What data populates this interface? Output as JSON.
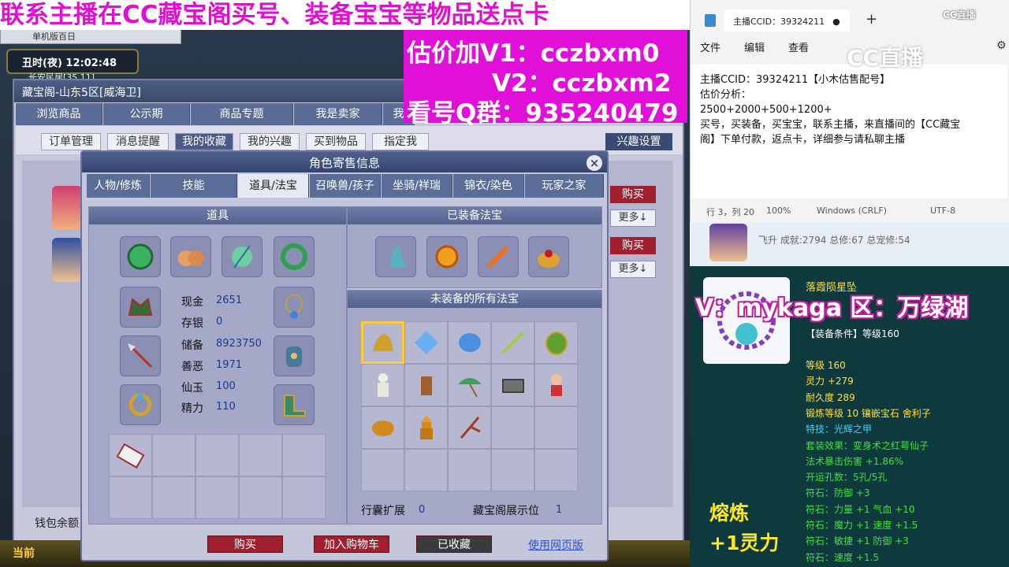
{
  "overlay": {
    "line1": "联系主播在CC藏宝阁买号、装备宝宝等物品送点卡",
    "line2": "估价加V1：cczbxm0",
    "line3": "V2：cczbxm2",
    "line4": "看号Q群：935240479"
  },
  "browser": {
    "tab_label": "单机版百日"
  },
  "game": {
    "clock": "丑时(夜)  12:02:48",
    "location": "长安民居[35,11]"
  },
  "window": {
    "title": "藏宝阁-山东5区[威海卫]",
    "main_tabs": [
      "浏览商品",
      "公示期",
      "商品专题",
      "我是卖家",
      "我"
    ],
    "sub_tabs": [
      "订单管理",
      "消息提醒",
      "我的收藏",
      "我的兴趣",
      "买到物品",
      "指定我"
    ],
    "interest_settings": "兴趣设置",
    "side_buttons": {
      "buy": "购买",
      "more": "更多↓"
    },
    "wallet_label": "钱包余额",
    "bottom_label": "当前"
  },
  "modal": {
    "title": "角色寄售信息",
    "close_icon": "close-icon",
    "tabs": [
      "人物/修炼",
      "技能",
      "道具/法宝",
      "召唤兽/孩子",
      "坐骑/祥瑞",
      "锦衣/染色",
      "玩家之家"
    ],
    "active_tab": 2,
    "items_panel": "道具",
    "equipped_treasures_panel": "已装备法宝",
    "unequipped_treasures_panel": "未装备的所有法宝",
    "stats": [
      {
        "label": "现金",
        "value": "2651"
      },
      {
        "label": "存银",
        "value": "0"
      },
      {
        "label": "储备",
        "value": "8923750"
      },
      {
        "label": "善恶",
        "value": "1971"
      },
      {
        "label": "仙玉",
        "value": "100"
      },
      {
        "label": "精力",
        "value": "110"
      }
    ],
    "bag_expand_label": "行囊扩展",
    "bag_expand_value": "0",
    "display_slots_label": "藏宝阁展示位",
    "display_slots_value": "1",
    "actions": {
      "buy": "购买",
      "add_cart": "加入购物车",
      "favorited": "已收藏",
      "web_version": "使用网页版"
    }
  },
  "notepad": {
    "tab_title": "主播CCID：39324211",
    "menu": [
      "文件",
      "编辑",
      "查看"
    ],
    "body_lines": [
      "主播CCID：39324211【小木估售配号】",
      "估价分析：",
      "2500+2000+500+1200+",
      "买号，买装备，买宝宝，联系主播，来直播间的【CC藏宝",
      "阁】下单付款，返点卡，详细参与请私聊主播"
    ],
    "status": {
      "position": "行 3，列 20",
      "zoom": "100%",
      "line_ending": "Windows (CRLF)",
      "encoding": "UTF-8"
    }
  },
  "cc_logo": "CC直播",
  "side_card": {
    "info": "飞升 成就:2794 总修:67 总宠修:54"
  },
  "tooltip": {
    "item_name": "落霞陨星坠",
    "watermark": "V：mykaga  区：万绿湖",
    "condition": "【装备条件】等级160",
    "lines": [
      {
        "text": "等级 160",
        "color": "#ffe040"
      },
      {
        "text": "灵力 +279",
        "color": "#ffe040"
      },
      {
        "text": "耐久度 289",
        "color": "#ffe040"
      },
      {
        "text": "锻炼等级 10  镶嵌宝石 舍利子",
        "color": "#ffe040"
      },
      {
        "text": "特技：光辉之甲",
        "color": "#40d0ff"
      },
      {
        "text": "套装效果：变身术之红萼仙子",
        "color": "#40e040"
      },
      {
        "text": "法术暴击伤害 +1.86%",
        "color": "#40e040"
      },
      {
        "text": "开运孔数：5孔/5孔",
        "color": "#40e040"
      },
      {
        "text": "符石：防御 +3",
        "color": "#40e040"
      },
      {
        "text": "符石：力量 +1  气血 +10",
        "color": "#40e040"
      },
      {
        "text": "符石：魔力 +1  速度 +1.5",
        "color": "#40e040"
      },
      {
        "text": "符石：敏捷 +1  防御 +3",
        "color": "#40e040"
      },
      {
        "text": "符石：速度 +1.5",
        "color": "#40e040"
      }
    ],
    "refine_title": "熔炼",
    "refine_bonus": "+1灵力"
  }
}
